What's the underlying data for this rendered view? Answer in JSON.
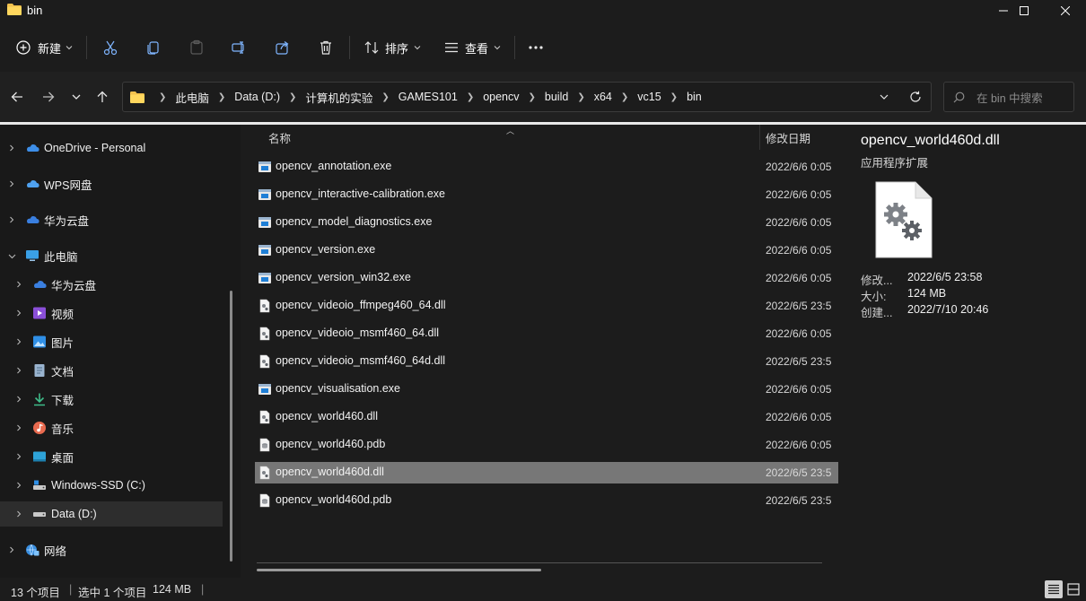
{
  "window": {
    "title": "bin",
    "icon": "folder-icon",
    "minimize_icon": "minimize-icon",
    "maximize_icon": "maximize-icon",
    "close_icon": "close-icon"
  },
  "toolbar": {
    "new_label": "新建",
    "sort_label": "排序",
    "view_label": "查看",
    "icons": [
      "plus-circle-icon",
      "cut-icon",
      "copy-icon",
      "paste-icon",
      "rename-icon",
      "share-icon",
      "delete-icon",
      "sort-icon",
      "view-icon",
      "more-icon"
    ]
  },
  "address": {
    "segments": [
      "此电脑",
      "Data (D:)",
      "计算机的实验",
      "GAMES101",
      "opencv",
      "build",
      "x64",
      "vc15",
      "bin"
    ],
    "search_placeholder": "在 bin 中搜索"
  },
  "sidebar": {
    "items": [
      {
        "label": "OneDrive - Personal",
        "icon": "cloud-icon"
      },
      {
        "label": "WPS网盘",
        "icon": "cloud-icon"
      },
      {
        "label": "华为云盘",
        "icon": "cloud-icon"
      },
      {
        "label": "此电脑",
        "icon": "computer-icon"
      },
      {
        "label": "华为云盘",
        "icon": "cloud-icon"
      },
      {
        "label": "视频",
        "icon": "video-icon"
      },
      {
        "label": "图片",
        "icon": "picture-icon"
      },
      {
        "label": "文档",
        "icon": "document-icon"
      },
      {
        "label": "下载",
        "icon": "download-icon"
      },
      {
        "label": "音乐",
        "icon": "music-icon"
      },
      {
        "label": "桌面",
        "icon": "desktop-icon"
      },
      {
        "label": "Windows-SSD (C:)",
        "icon": "drive-icon"
      },
      {
        "label": "Data (D:)",
        "icon": "drive-icon"
      },
      {
        "label": "网络",
        "icon": "network-icon"
      }
    ]
  },
  "columns": {
    "name": "名称",
    "modified": "修改日期"
  },
  "files": [
    {
      "name": "opencv_annotation.exe",
      "date": "2022/6/6 0:05",
      "type": "exe"
    },
    {
      "name": "opencv_interactive-calibration.exe",
      "date": "2022/6/6 0:05",
      "type": "exe"
    },
    {
      "name": "opencv_model_diagnostics.exe",
      "date": "2022/6/6 0:05",
      "type": "exe"
    },
    {
      "name": "opencv_version.exe",
      "date": "2022/6/6 0:05",
      "type": "exe"
    },
    {
      "name": "opencv_version_win32.exe",
      "date": "2022/6/6 0:05",
      "type": "exe"
    },
    {
      "name": "opencv_videoio_ffmpeg460_64.dll",
      "date": "2022/6/5 23:5",
      "type": "dll"
    },
    {
      "name": "opencv_videoio_msmf460_64.dll",
      "date": "2022/6/6 0:05",
      "type": "dll"
    },
    {
      "name": "opencv_videoio_msmf460_64d.dll",
      "date": "2022/6/5 23:5",
      "type": "dll"
    },
    {
      "name": "opencv_visualisation.exe",
      "date": "2022/6/6 0:05",
      "type": "exe"
    },
    {
      "name": "opencv_world460.dll",
      "date": "2022/6/6 0:05",
      "type": "dll"
    },
    {
      "name": "opencv_world460.pdb",
      "date": "2022/6/6 0:05",
      "type": "pdb"
    },
    {
      "name": "opencv_world460d.dll",
      "date": "2022/6/5 23:5",
      "type": "dll",
      "selected": true
    },
    {
      "name": "opencv_world460d.pdb",
      "date": "2022/6/5 23:5",
      "type": "pdb"
    }
  ],
  "details": {
    "name": "opencv_world460d.dll",
    "type": "应用程序扩展",
    "props": [
      {
        "label": "修改...",
        "value": "2022/6/5 23:58"
      },
      {
        "label": "大小:",
        "value": "124 MB"
      },
      {
        "label": "创建...",
        "value": "2022/7/10 20:46"
      }
    ]
  },
  "status": {
    "count": "13 个项目",
    "selected": "选中 1 个项目",
    "size": "124 MB",
    "view_icons": [
      "details-view-icon",
      "tiles-view-icon"
    ]
  }
}
